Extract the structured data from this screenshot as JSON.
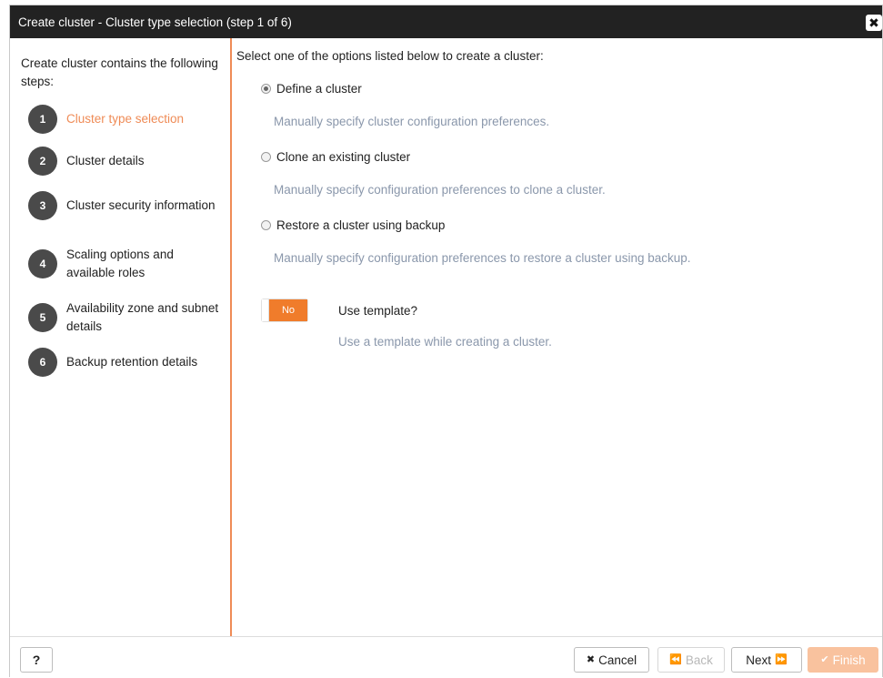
{
  "window": {
    "title": "Create cluster - Cluster type selection (step 1 of 6)",
    "close_icon": "close-icon"
  },
  "sidebar": {
    "intro": "Create cluster contains the following steps:",
    "steps": [
      {
        "number": "1",
        "label": "Cluster type selection",
        "active": true
      },
      {
        "number": "2",
        "label": "Cluster details"
      },
      {
        "number": "3",
        "label": "Cluster security information"
      },
      {
        "number": "4",
        "label": "Scaling options and available roles"
      },
      {
        "number": "5",
        "label": "Availability zone and subnet details"
      },
      {
        "number": "6",
        "label": "Backup retention details"
      }
    ]
  },
  "main": {
    "intro": "Select one of the options listed below to create a cluster:",
    "options": [
      {
        "label": "Define a cluster",
        "description": "Manually specify cluster configuration preferences.",
        "selected": true
      },
      {
        "label": "Clone an existing cluster",
        "description": "Manually specify configuration preferences to clone a cluster.",
        "selected": false
      },
      {
        "label": "Restore a cluster using backup",
        "description": "Manually specify configuration preferences to restore a cluster using backup.",
        "selected": false
      }
    ],
    "template": {
      "toggle_value": "No",
      "label": "Use template?",
      "description": "Use a template while creating a cluster."
    }
  },
  "footer": {
    "help_label": "?",
    "cancel_label": "Cancel",
    "back_label": "Back",
    "next_label": "Next",
    "finish_label": "Finish"
  },
  "colors": {
    "accent": "#ef8b56",
    "toggle_off": "#f07c2b",
    "titlebar": "#222222",
    "description_text": "#8a97ab"
  }
}
